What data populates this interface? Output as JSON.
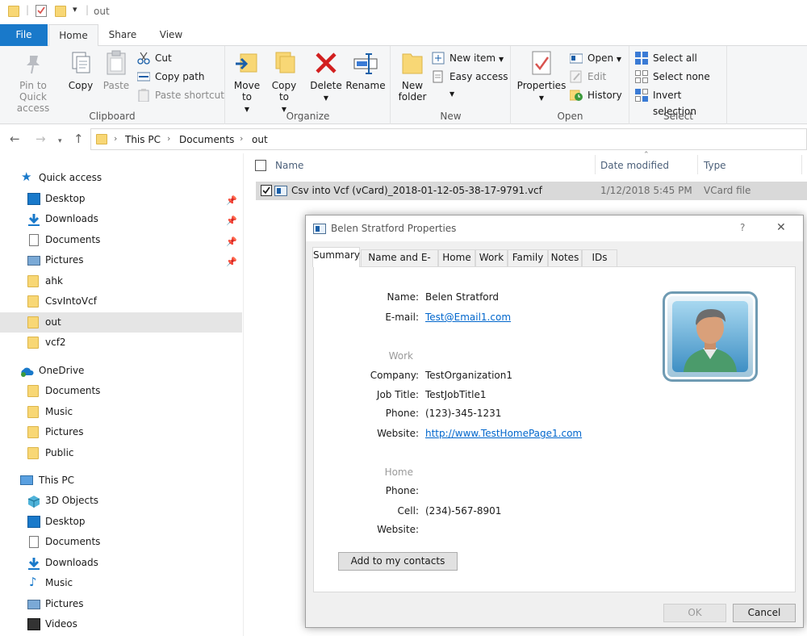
{
  "window": {
    "title": "out"
  },
  "ribbon_tabs": {
    "file": "File",
    "home": "Home",
    "share": "Share",
    "view": "View"
  },
  "ribbon": {
    "clipboard": {
      "pin": "Pin to Quick access",
      "copy": "Copy",
      "paste": "Paste",
      "cut": "Cut",
      "copy_path": "Copy path",
      "paste_shortcut": "Paste shortcut",
      "label": "Clipboard"
    },
    "organize": {
      "move_to": "Move to",
      "copy_to": "Copy to",
      "delete": "Delete",
      "rename": "Rename",
      "label": "Organize"
    },
    "new": {
      "new_folder": "New folder",
      "new_item": "New item",
      "easy_access": "Easy access",
      "label": "New"
    },
    "open": {
      "properties": "Properties",
      "open": "Open",
      "edit": "Edit",
      "history": "History",
      "label": "Open"
    },
    "select": {
      "select_all": "Select all",
      "select_none": "Select none",
      "invert": "Invert selection",
      "label": "Select"
    }
  },
  "address": {
    "crumbs": [
      "This PC",
      "Documents",
      "out"
    ]
  },
  "sidebar": {
    "quick_access": "Quick access",
    "quick_items": [
      "Desktop",
      "Downloads",
      "Documents",
      "Pictures",
      "ahk",
      "CsvIntoVcf",
      "out",
      "vcf2"
    ],
    "onedrive": "OneDrive",
    "onedrive_items": [
      "Documents",
      "Music",
      "Pictures",
      "Public"
    ],
    "this_pc": "This PC",
    "pc_items": [
      "3D Objects",
      "Desktop",
      "Documents",
      "Downloads",
      "Music",
      "Pictures",
      "Videos"
    ]
  },
  "file_list": {
    "headers": {
      "name": "Name",
      "date": "Date modified",
      "type": "Type"
    },
    "rows": [
      {
        "name": "Csv into Vcf (vCard)_2018-01-12-05-38-17-9791.vcf",
        "date": "1/12/2018 5:45 PM",
        "type": "VCard file"
      }
    ]
  },
  "dialog": {
    "title": "Belen Stratford Properties",
    "help": "?",
    "close": "✕",
    "tabs": [
      "Summary",
      "Name and E-mail",
      "Home",
      "Work",
      "Family",
      "Notes",
      "IDs"
    ],
    "fields": {
      "name_label": "Name:",
      "name": "Belen Stratford",
      "email_label": "E-mail:",
      "email": "Test@Email1.com",
      "work_section": "Work",
      "company_label": "Company:",
      "company": "TestOrganization1",
      "jobtitle_label": "Job Title:",
      "jobtitle": "TestJobTitle1",
      "work_phone_label": "Phone:",
      "work_phone": "(123)-345-1231",
      "work_website_label": "Website:",
      "work_website": "http://www.TestHomePage1.com",
      "home_section": "Home",
      "home_phone_label": "Phone:",
      "cell_label": "Cell:",
      "cell": "(234)-567-8901",
      "home_website_label": "Website:"
    },
    "add_contacts": "Add to my contacts",
    "ok": "OK",
    "cancel": "Cancel"
  },
  "colors": {
    "accent": "#1979ca",
    "link": "#0066cc",
    "selection": "#d9d9d9",
    "folder": "#f8d775"
  }
}
